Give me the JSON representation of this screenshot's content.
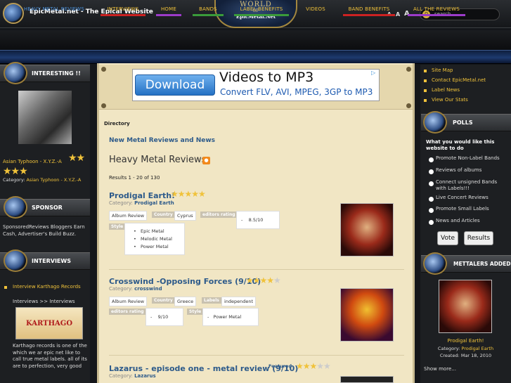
{
  "header": {
    "site_title": "EpicMetal.net - The Epical Website",
    "logo_top": "WORLD",
    "logo_mid": "OF",
    "logo_bottom": "EpicMetal.Net",
    "font_sizes": [
      "A",
      "A",
      "A"
    ],
    "search_placeholder": "search..."
  },
  "nav": [
    {
      "label": "HEAVY METAL REVIEWS",
      "color": "#4a90d9"
    },
    {
      "label": "INTERVIEWS",
      "color": "#cc2222"
    },
    {
      "label": "HOME",
      "color": "#9c3bc9"
    },
    {
      "label": "BANDS",
      "color": "#3a9b3a"
    },
    {
      "label": "LABEL BENEFITS",
      "color": "#3a9b3a"
    },
    {
      "label": "VIDEOS",
      "color": ""
    },
    {
      "label": "BAND BENEFITS",
      "color": "#cc2222"
    },
    {
      "label": "ALL THE REVIEWS",
      "color": "#9c3bc9"
    }
  ],
  "left": {
    "interesting": {
      "title": "INTERESTING !!",
      "caption": "Asian Typhoon - X.Y.Z.-A",
      "category_label": "Category:",
      "category": "Asian Typhoon - X.Y.Z.-A"
    },
    "sponsor": {
      "title": "SPONSOR",
      "text": "SponsoredReviews Bloggers Earn Cash, Advertiser's Build Buzz."
    },
    "interviews": {
      "title": "INTERVIEWS",
      "link": "Interview Karthago Records",
      "crumb": "Interviews >> Interviews",
      "logo_text": "KARTHAGO",
      "body": "Karthago records is one of the which we ar epic net like to call true metal labels. all of its are to perfection, very good"
    }
  },
  "ad": {
    "button": "Download",
    "line1": "Videos to MP3",
    "line2": "Convert FLV, AVI, MPEG, 3GP to MP3"
  },
  "main": {
    "directory": "Directory",
    "news_link": "New Metal Reviews and News",
    "heading": "Heavy Metal Reviews",
    "results": "Results 1 - 20 of 130",
    "reviews": [
      {
        "title": "Prodigal Earth!",
        "rating": 5,
        "category_label": "Category:",
        "category": "Prodigal Earth",
        "type": "Album Review",
        "country_label": "Country",
        "country": "Cyprus",
        "ed_label": "editors rating",
        "ed_value": "8.5/10",
        "style_label": "Style",
        "styles": [
          "Epic Metal",
          "Melodic Metal",
          "Power Metal"
        ]
      },
      {
        "title": "Crosswind -Opposing Forces (9/10)",
        "rating": 4,
        "category_label": "Category:",
        "category": "crosswind",
        "type": "Album Review",
        "country_label": "Country",
        "country": "Greece",
        "labels_label": "Labels",
        "labels": "independent",
        "ed_label": "editors rating",
        "ed_value": "9/10",
        "style_label": "Style",
        "styles": [
          "Power Metal"
        ]
      },
      {
        "title": "Lazarus - episode one - metal review (9/10)",
        "featured": "Featured",
        "rating": 3,
        "category_label": "Category:",
        "category": "Lazarus"
      }
    ]
  },
  "right": {
    "links": [
      "Site Map",
      "Contact EpicMetal.net",
      "Label News",
      "View Our Stats"
    ],
    "polls": {
      "title": "POLLS",
      "question": "What you would like this website to do",
      "options": [
        "Promote Non-Label Bands",
        "Reviews of albums",
        "Connect unsigned Bands with Labels!!!",
        "Live Concert Reviews",
        "Promote Small Labels",
        "News and Articles"
      ],
      "vote": "Vote",
      "results": "Results"
    },
    "metallers": {
      "title": "METTALERS ADDED",
      "caption": "Prodigal Earth!",
      "category_label": "Category:",
      "category": "Prodigal Earth",
      "created": "Created: Mar 18, 2010",
      "more": "Show more..."
    }
  }
}
